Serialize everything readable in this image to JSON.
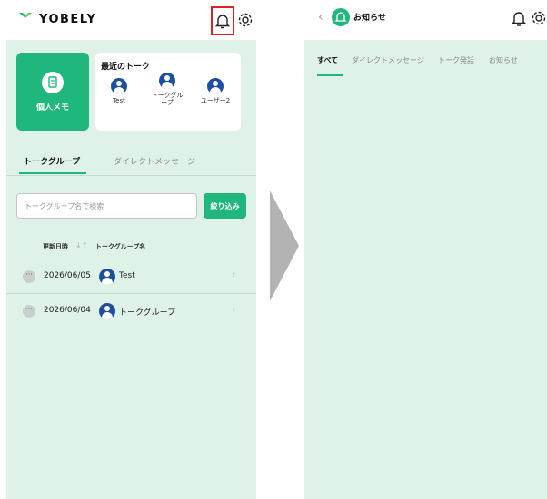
{
  "left": {
    "brand": "YOBELY",
    "memo_label": "個人メモ",
    "recent": {
      "title": "最近のトーク",
      "items": [
        {
          "name": "Test"
        },
        {
          "name": "トークグル\nープ"
        },
        {
          "name": "ユーザー2"
        }
      ]
    },
    "tabs": [
      {
        "label": "トークグループ",
        "active": true
      },
      {
        "label": "ダイレクトメッセージ",
        "active": false
      }
    ],
    "search": {
      "placeholder": "トークグループ名で検索"
    },
    "filter_label": "絞り込み",
    "columns": {
      "updated": "更新日時",
      "name": "トークグループ名"
    },
    "rows": [
      {
        "date": "2026/06/05",
        "name": "Test"
      },
      {
        "date": "2026/06/04",
        "name": "トークグループ"
      }
    ]
  },
  "right": {
    "title": "お知らせ",
    "tabs": [
      {
        "label": "すべて",
        "active": true
      },
      {
        "label": "ダイレクトメッセージ",
        "active": false
      },
      {
        "label": "トーク発話",
        "active": false
      },
      {
        "label": "お知らせ",
        "active": false
      }
    ]
  },
  "colors": {
    "accent": "#1fb77e",
    "panel_bg": "#dff2e8",
    "highlight": "#e02020",
    "avatar": "#1c4fa0"
  },
  "icons": {
    "bell": "bell-icon",
    "gear": "gear-icon",
    "memo": "document-icon",
    "back": "chevron-left-icon"
  }
}
